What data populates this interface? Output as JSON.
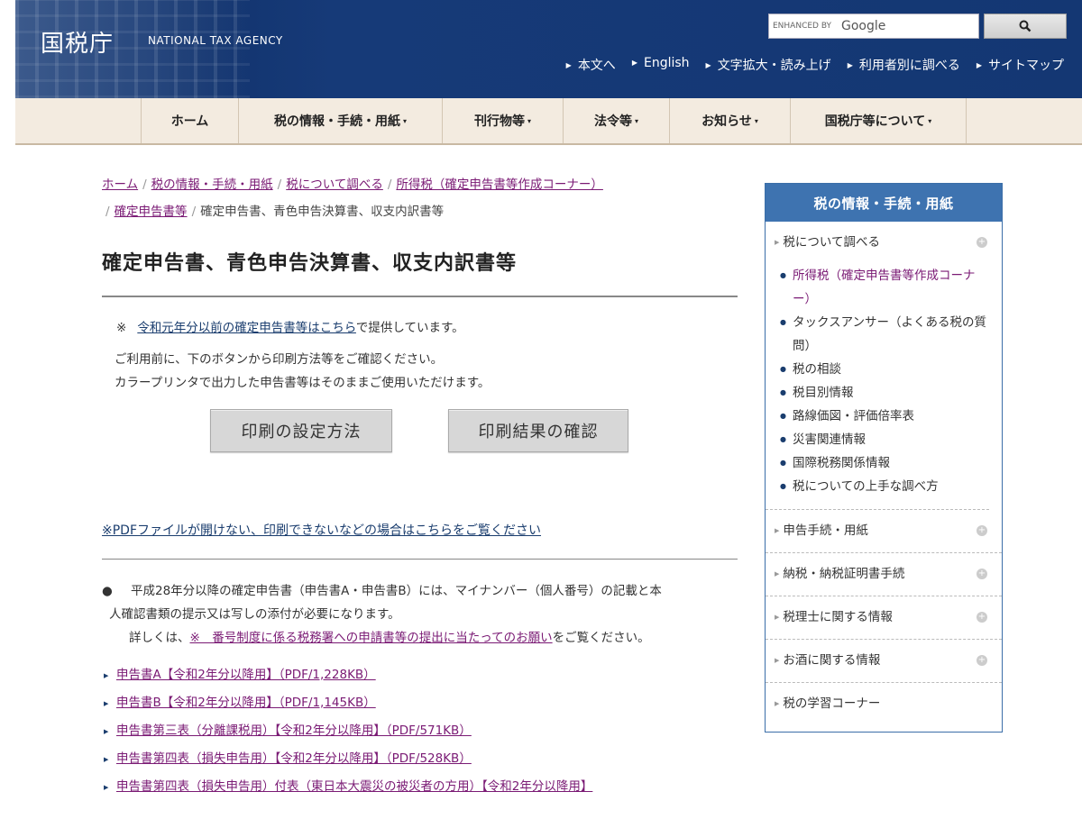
{
  "header": {
    "logo": "国税庁",
    "logo_en": "NATIONAL TAX AGENCY",
    "search_enhanced": "ENHANCED BY",
    "search_brand": "Google",
    "search_icon": "magnifier-icon",
    "util_links": [
      "本文へ",
      "English",
      "文字拡大・読み上げ",
      "利用者別に調べる",
      "サイトマップ"
    ]
  },
  "gnav": {
    "items": [
      {
        "label": "ホーム",
        "dropdown": false
      },
      {
        "label": "税の情報・手続・用紙",
        "dropdown": true
      },
      {
        "label": "刊行物等",
        "dropdown": true
      },
      {
        "label": "法令等",
        "dropdown": true
      },
      {
        "label": "お知らせ",
        "dropdown": true
      },
      {
        "label": "国税庁等について",
        "dropdown": true
      }
    ],
    "caret": "▾"
  },
  "breadcrumb": {
    "items": [
      "ホーム",
      "税の情報・手続・用紙",
      "税について調べる",
      "所得税（確定申告書等作成コーナー）",
      "確定申告書等"
    ],
    "current": "確定申告書、青色申告決算書、収支内訳書等",
    "sep": "/"
  },
  "main": {
    "title": "確定申告書、青色申告決算書、収支内訳書等",
    "note_mark": "※",
    "note_link": "令和元年分以前の確定申告書等はこちら",
    "note_suffix": "で提供しています。",
    "usage_line1": "ご利用前に、下のボタンから印刷方法等をご確認ください。",
    "usage_line2": "カラープリンタで出力した申告書等はそのままご使用いただけます。",
    "btn_settings": "印刷の設定方法",
    "btn_check": "印刷結果の確認",
    "pdf_help": "※PDFファイルが開けない、印刷できないなどの場合はこちらをご覧ください",
    "bullet_dot": "●",
    "bullet_line1": "平成28年分以降の確定申告書（申告書A・申告書B）には、マイナンバー（個人番号）の記載と本",
    "bullet_line2": "人確認書類の提示又は写しの添付が必要になります。",
    "bullet_prefix": "詳しくは、",
    "bullet_link": "※　番号制度に係る税務署への申請書等の提出に当たってのお願い",
    "bullet_suffix": "をご覧ください。",
    "files": [
      "申告書A【令和2年分以降用】（PDF/1,228KB）",
      "申告書B【令和2年分以降用】（PDF/1,145KB）",
      "申告書第三表（分離課税用）【令和2年分以降用】（PDF/571KB）",
      "申告書第四表（損失申告用）【令和2年分以降用】（PDF/528KB）",
      "申告書第四表（損失申告用）付表（東日本大震災の被災者の方用）【令和2年分以降用】"
    ]
  },
  "sidebar": {
    "title": "税の情報・手続・用紙",
    "sec1": "税について調べる",
    "sub": [
      "所得税（確定申告書等作成コーナー）",
      "タックスアンサー（よくある税の質問）",
      "税の相談",
      "税目別情報",
      "路線価図・評価倍率表",
      "災害関連情報",
      "国際税務関係情報",
      "税についての上手な調べ方"
    ],
    "sections": [
      "申告手続・用紙",
      "納税・納税証明書手続",
      "税理士に関する情報",
      "お酒に関する情報",
      "税の学習コーナー"
    ],
    "plus": "+"
  }
}
